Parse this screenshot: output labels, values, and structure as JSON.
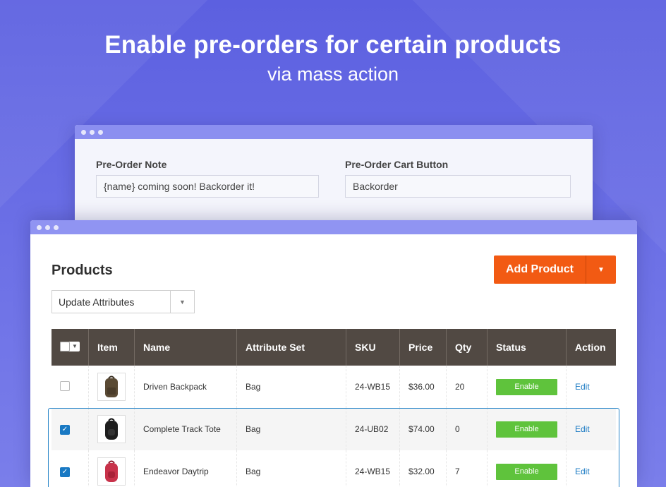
{
  "hero": {
    "title": "Enable pre-orders for certain products",
    "subtitle": "via mass action"
  },
  "settings_window": {
    "note_label": "Pre-Order Note",
    "note_value": "{name} coming soon! Backorder it!",
    "cart_button_label": "Pre-Order Cart Button",
    "cart_button_value": "Backorder"
  },
  "products_window": {
    "title": "Products",
    "add_button_label": "Add Product",
    "mass_action_value": "Update Attributes",
    "columns": [
      "Item",
      "Name",
      "Attribute Set",
      "SKU",
      "Price",
      "Qty",
      "Status",
      "Action"
    ],
    "rows": [
      {
        "checked": false,
        "image": "backpack-brown",
        "name": "Driven Backpack",
        "attribute_set": "Bag",
        "sku": "24-WB15",
        "price": "$36.00",
        "qty": "20",
        "status": "Enable",
        "action": "Edit"
      },
      {
        "checked": true,
        "image": "backpack-black",
        "name": "Complete Track Tote",
        "attribute_set": "Bag",
        "sku": "24-UB02",
        "price": "$74.00",
        "qty": "0",
        "status": "Enable",
        "action": "Edit"
      },
      {
        "checked": true,
        "image": "backpack-red",
        "name": "Endeavor Daytrip",
        "attribute_set": "Bag",
        "sku": "24-WB15",
        "price": "$32.00",
        "qty": "7",
        "status": "Enable",
        "action": "Edit"
      }
    ]
  },
  "colors": {
    "background": "#5c60e0",
    "window_titlebar": "#8b8ff0",
    "add_button": "#f25a13",
    "table_header": "#514943",
    "status_enable": "#5fc33c",
    "link": "#1979c3"
  }
}
